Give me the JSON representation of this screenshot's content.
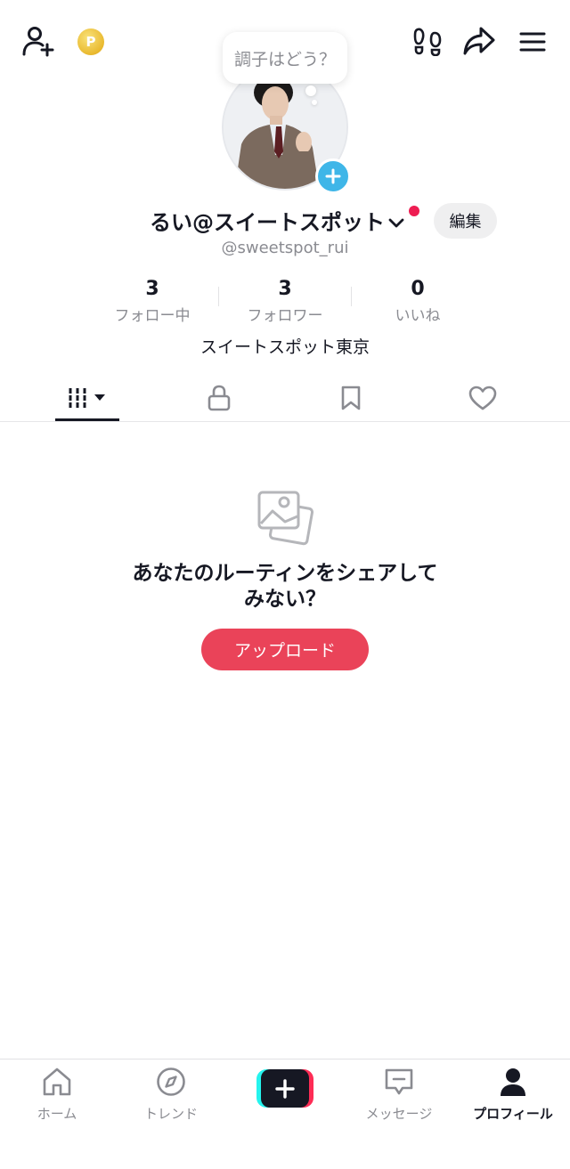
{
  "speech_bubble": {
    "text": "調子はどう？"
  },
  "profile": {
    "name": "るい@スイートスポット",
    "handle": "@sweetspot_rui",
    "edit_label": "編集",
    "bio": "スイートスポット東京"
  },
  "stats": [
    {
      "value": "3",
      "label": "フォロー中"
    },
    {
      "value": "3",
      "label": "フォロワー"
    },
    {
      "value": "0",
      "label": "いいね"
    }
  ],
  "empty_state": {
    "line1": "あなたのルーティンをシェアして",
    "line2": "みない？",
    "upload_label": "アップロード"
  },
  "bottom_nav": {
    "home": "ホーム",
    "trend": "トレンド",
    "messages": "メッセージ",
    "profile": "プロフィール"
  },
  "colors": {
    "accent_red": "#ea4359",
    "notification_dot": "#ee1d52",
    "add_avatar_blue": "#3fb6e8",
    "coin_gold": "#e9b92f"
  },
  "icons": {
    "add_friend": "add-person-icon",
    "coin": "coin-icon",
    "footprints": "footprint-icon",
    "share": "share-arrow-icon",
    "menu": "hamburger-icon"
  }
}
